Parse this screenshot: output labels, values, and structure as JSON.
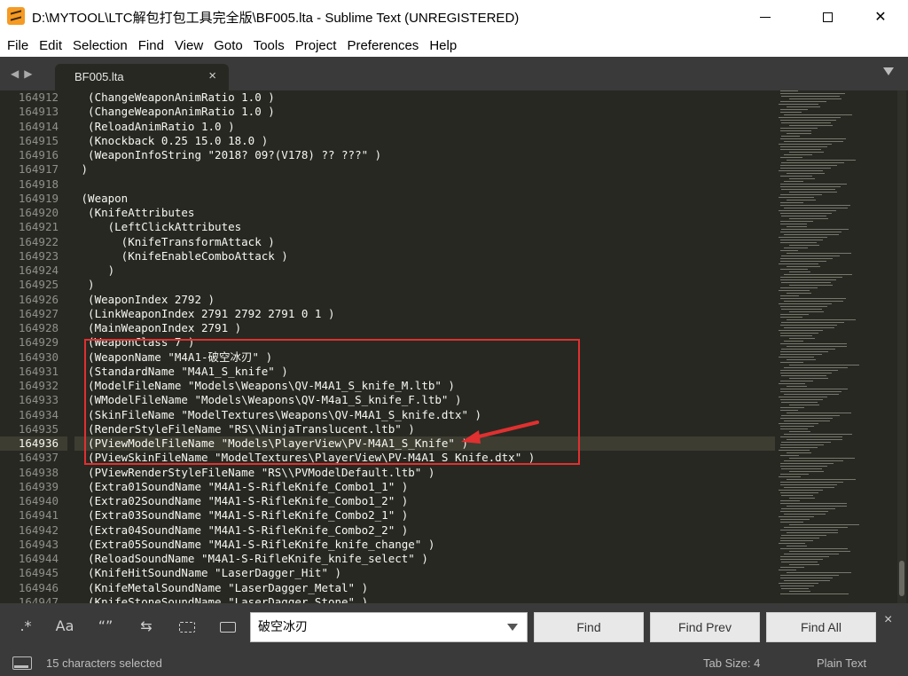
{
  "window": {
    "title": "D:\\MYTOOL\\LTC解包打包工具完全版\\BF005.lta - Sublime Text (UNREGISTERED)"
  },
  "menu": [
    "File",
    "Edit",
    "Selection",
    "Find",
    "View",
    "Goto",
    "Tools",
    "Project",
    "Preferences",
    "Help"
  ],
  "tab": {
    "label": "BF005.lta",
    "close": "×"
  },
  "editor": {
    "line_numbers": [
      "164912",
      "164913",
      "164914",
      "164915",
      "164916",
      "164917",
      "164918",
      "164919",
      "164920",
      "164921",
      "164922",
      "164923",
      "164924",
      "164925",
      "164926",
      "164927",
      "164928",
      "164929",
      "164930",
      "164931",
      "164932",
      "164933",
      "164934",
      "164935",
      "164936",
      "164937",
      "164938",
      "164939",
      "164940",
      "164941",
      "164942",
      "164943",
      "164944",
      "164945",
      "164946",
      "164947"
    ],
    "current_line": "164936",
    "lines": [
      "  (ChangeWeaponAnimRatio 1.0 )",
      "  (ChangeWeaponAnimRatio 1.0 )",
      "  (ReloadAnimRatio 1.0 )",
      "  (Knockback 0.25 15.0 18.0 )",
      "  (WeaponInfoString \"2018? 09?(V178) ?? ???\" )",
      " )",
      "",
      " (Weapon",
      "  (KnifeAttributes",
      "     (LeftClickAttributes",
      "       (KnifeTransformAttack )",
      "       (KnifeEnableComboAttack )",
      "     )",
      "  )",
      "  (WeaponIndex 2792 )",
      "  (LinkWeaponIndex 2791 2792 2791 0 1 )",
      "  (MainWeaponIndex 2791 )",
      "  (WeaponClass 7 )",
      "  (WeaponName \"M4A1-破空冰刃\" )",
      "  (StandardName \"M4A1_S_knife\" )",
      "  (ModelFileName \"Models\\Weapons\\QV-M4A1_S_knife_M.ltb\" )",
      "  (WModelFileName \"Models\\Weapons\\QV-M4a1_S_knife_F.ltb\" )",
      "  (SkinFileName \"ModelTextures\\Weapons\\QV-M4A1_S_knife.dtx\" )",
      "  (RenderStyleFileName \"RS\\\\NinjaTranslucent.ltb\" )",
      "  (PViewModelFileName \"Models\\PlayerView\\PV-M4A1_S_Knife\" )",
      "  (PViewSkinFileName \"ModelTextures\\PlayerView\\PV-M4A1_S_Knife.dtx\" )",
      "  (PViewRenderStyleFileName \"RS\\\\PVModelDefault.ltb\" )",
      "  (Extra01SoundName \"M4A1-S-RifleKnife_Combo1_1\" )",
      "  (Extra02SoundName \"M4A1-S-RifleKnife_Combo1_2\" )",
      "  (Extra03SoundName \"M4A1-S-RifleKnife_Combo2_1\" )",
      "  (Extra04SoundName \"M4A1-S-RifleKnife_Combo2_2\" )",
      "  (Extra05SoundName \"M4A1-S-RifleKnife_knife_change\" )",
      "  (ReloadSoundName \"M4A1-S-RifleKnife_knife_select\" )",
      "  (KnifeHitSoundName \"LaserDagger_Hit\" )",
      "  (KnifeMetalSoundName \"LaserDagger_Metal\" )",
      "  (KnifeStoneSoundName \"LaserDagger_Stone\" )"
    ]
  },
  "find": {
    "query": "破空冰刃",
    "options": {
      "regex": ".*",
      "case": "Aa",
      "word": "“”",
      "wrap": "wrap-icon",
      "in_selection": "in-selection-icon",
      "highlight": "highlight-icon"
    },
    "find_label": "Find",
    "find_prev_label": "Find Prev",
    "find_all_label": "Find All",
    "close": "×"
  },
  "status": {
    "selection": "15 characters selected",
    "tab_size": "Tab Size: 4",
    "syntax": "Plain Text"
  },
  "colors": {
    "editor_bg": "#272822",
    "panel_bg": "#3a3a3a",
    "annotation_red": "#e03030"
  }
}
